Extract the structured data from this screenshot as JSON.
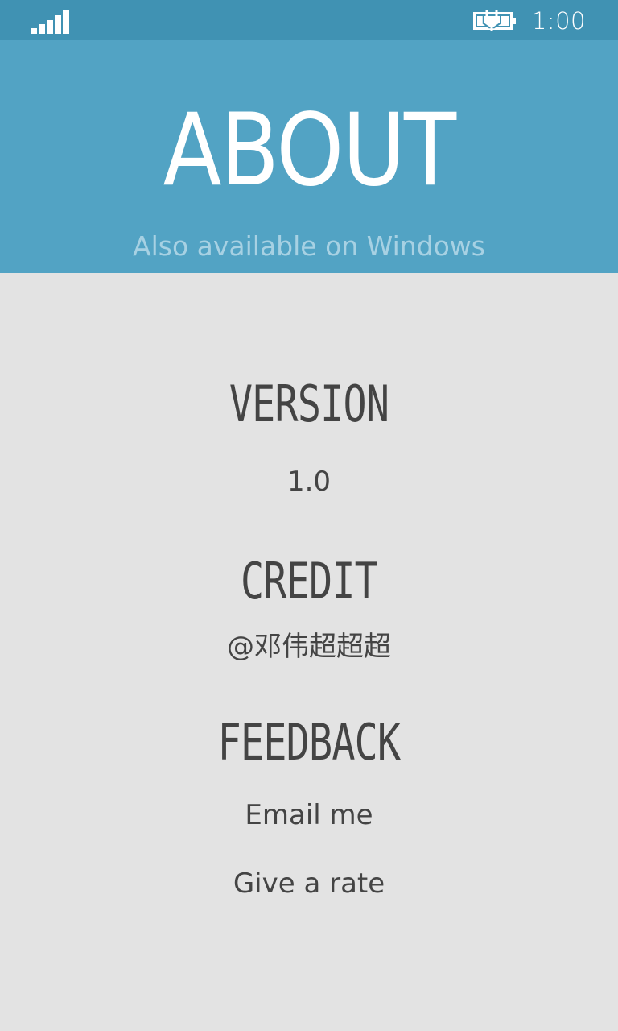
{
  "status_bar": {
    "time": "1:00",
    "signal_icon": "signal-strength-icon",
    "battery_icon": "battery-charging-icon",
    "colors": {
      "background": "#4092b3",
      "foreground": "#ffffff"
    }
  },
  "header": {
    "title": "ABOUT",
    "subtitle": "Also available on Windows",
    "colors": {
      "background": "#52a3c4",
      "title": "#ffffff",
      "subtitle": "#a7d1e3"
    }
  },
  "sections": {
    "version": {
      "heading": "VERSION",
      "value": "1.0"
    },
    "credit": {
      "heading": "CREDIT",
      "value": "@邓伟超超超"
    },
    "feedback": {
      "heading": "FEEDBACK",
      "email_label": "Email me",
      "rate_label": "Give a rate"
    }
  },
  "colors": {
    "page_background": "#e3e3e3",
    "text": "#444444"
  }
}
